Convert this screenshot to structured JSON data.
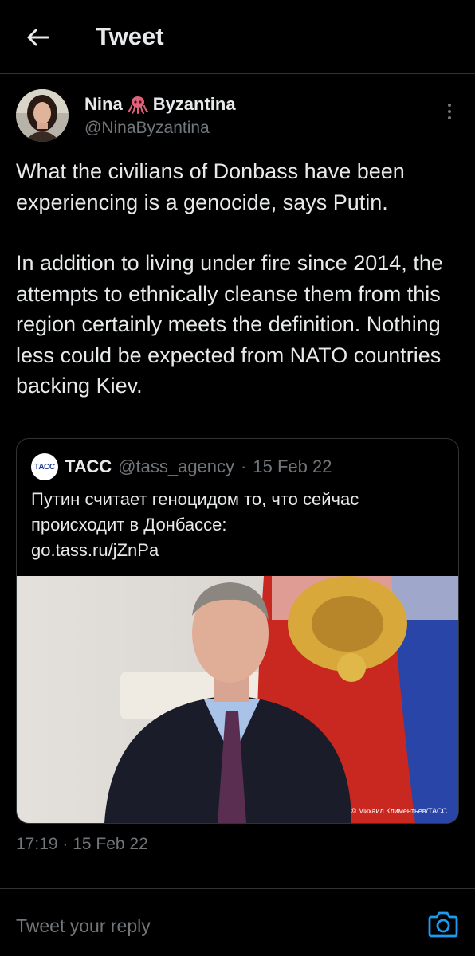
{
  "header": {
    "title": "Tweet",
    "back_icon": "arrow-left-icon"
  },
  "tweet": {
    "author": {
      "name_first": "Nina",
      "name_emoji": "octopus-icon",
      "name_last": "Byzantina",
      "handle": "@NinaByzantina"
    },
    "paragraphs": [
      "What the civilians of Donbass have been experiencing is a genocide, says Putin.",
      "In addition to living under fire since 2014, the attempts to ethnically cleanse them from this region certainly meets the definition. Nothing less could be expected from NATO countries backing Kiev."
    ],
    "timestamp": "17:19 · 15 Feb 22"
  },
  "quote": {
    "logo_text": "ТАСС",
    "name": "ТАСС",
    "handle": "@tass_agency",
    "separator": "·",
    "date": "15 Feb 22",
    "text": "Путин считает геноцидом то, что сейчас происходит в Донбассе:",
    "link": "go.tass.ru/jZnPa",
    "image_credit": "© Михаил Климентьев/ТАСС"
  },
  "reply": {
    "placeholder": "Tweet your reply",
    "camera_icon": "camera-icon"
  },
  "colors": {
    "background": "#000000",
    "text": "#e7e9ea",
    "secondary": "#71767b",
    "accent": "#1d9bf0",
    "border": "#2f3336"
  }
}
